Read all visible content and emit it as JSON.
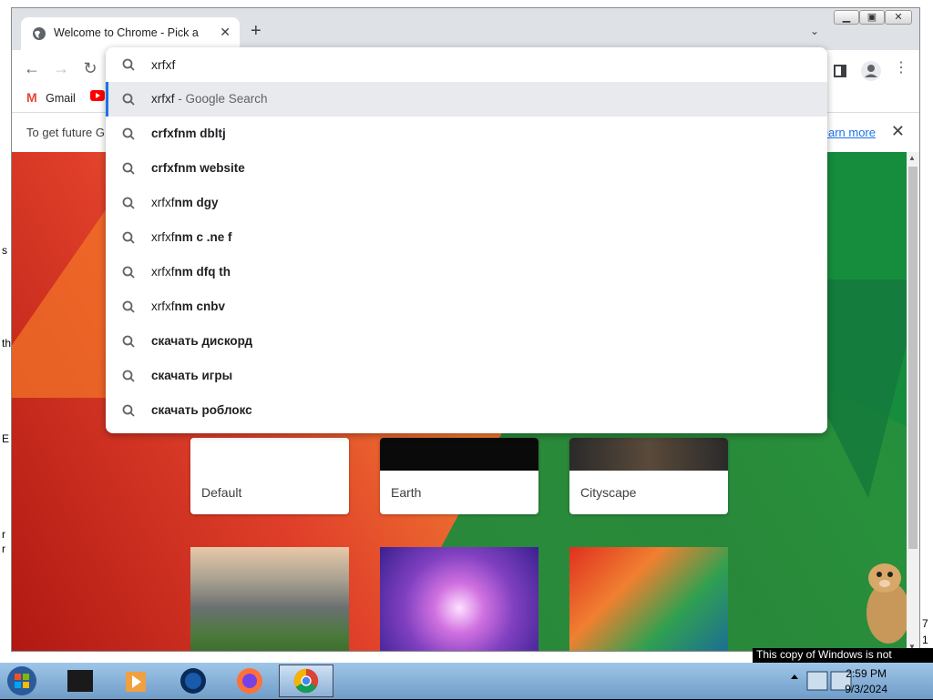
{
  "window": {
    "tab_title": "Welcome to Chrome - Pick a background",
    "new_tab_icon": "plus-icon",
    "tab_search_icon": "chevron-down-icon"
  },
  "toolbar": {
    "back_icon": "back-arrow-icon",
    "forward_icon": "forward-arrow-icon",
    "reload_icon": "reload-icon",
    "sidepanel_icon": "side-panel-icon",
    "profile_icon": "profile-icon",
    "menu_icon": "kebab-menu-icon"
  },
  "bookmarks": [
    {
      "label": "Gmail",
      "icon": "gmail-icon"
    },
    {
      "label": "",
      "icon": "youtube-icon"
    }
  ],
  "infobar": {
    "text": "To get future G",
    "learn_more": "Learn more",
    "close_icon": "close-icon"
  },
  "omnibox": {
    "value": "xrfxf",
    "suggestions": [
      {
        "plain": "xrfxf",
        "bold": "",
        "sub": " - Google Search",
        "selected": true
      },
      {
        "plain": "",
        "bold": "crfxfnm dbltj",
        "sub": ""
      },
      {
        "plain": "",
        "bold": "crfxfnm website",
        "sub": ""
      },
      {
        "plain": "xrfxf",
        "bold": "nm dgy",
        "sub": ""
      },
      {
        "plain": "xrfxf",
        "bold": "nm c .ne f",
        "sub": ""
      },
      {
        "plain": "xrfxf",
        "bold": "nm dfq th",
        "sub": ""
      },
      {
        "plain": "xrfxf",
        "bold": "nm cnbv",
        "sub": ""
      },
      {
        "plain": "",
        "bold": "скачать дискорд",
        "sub": ""
      },
      {
        "plain": "",
        "bold": "скачать игры",
        "sub": ""
      },
      {
        "plain": "",
        "bold": "скачать роблокс",
        "sub": ""
      }
    ]
  },
  "backgrounds": {
    "cards": [
      {
        "label": "Default"
      },
      {
        "label": "Earth"
      },
      {
        "label": "Cityscape"
      }
    ]
  },
  "desktop": {
    "genuine_notice": "This copy of Windows is not genuine",
    "edge_letters": [
      "s",
      "th",
      "E",
      "r",
      "r"
    ],
    "right_edge_digits": [
      "7",
      "1"
    ]
  },
  "taskbar": {
    "time": "2:59 PM",
    "date": "9/3/2024",
    "items": [
      "start-orb-icon",
      "desktop-app-icon",
      "media-player-icon",
      "globe-app-icon",
      "firefox-icon",
      "chrome-icon"
    ]
  }
}
